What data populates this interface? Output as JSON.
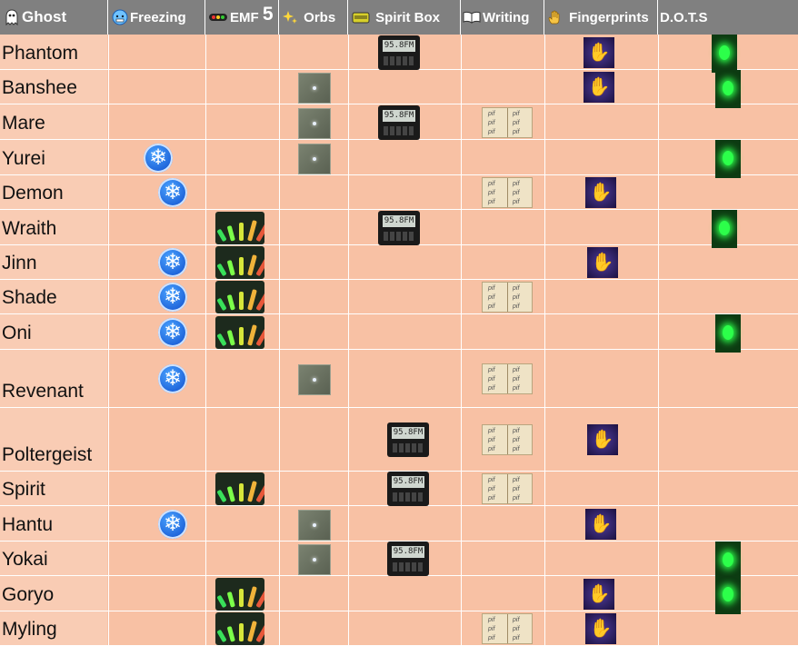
{
  "headers": [
    {
      "label": "Ghost",
      "icon": "ghost-icon"
    },
    {
      "label": "Freezing",
      "icon": "freezing-face-icon"
    },
    {
      "label": "EMF",
      "extra": "5",
      "icon": "emf-reader-icon"
    },
    {
      "label": "Orbs",
      "icon": "sparkles-icon"
    },
    {
      "label": "Spirit Box",
      "icon": "spirit-box-icon"
    },
    {
      "label": "Writing",
      "icon": "open-book-icon"
    },
    {
      "label": "Fingerprints",
      "icon": "raised-hand-icon"
    },
    {
      "label": "D.O.T.S",
      "icon": ""
    }
  ],
  "spirit_box_display": "95.8FM",
  "book_text": "pif",
  "ghosts": [
    {
      "name": "Phantom",
      "evidence": [
        "spiritbox",
        "fingerprints",
        "dots"
      ]
    },
    {
      "name": "Banshee",
      "evidence": [
        "orbs",
        "fingerprints",
        "dots"
      ]
    },
    {
      "name": "Mare",
      "evidence": [
        "orbs",
        "spiritbox",
        "writing"
      ]
    },
    {
      "name": "Yurei",
      "evidence": [
        "freezing",
        "orbs",
        "dots"
      ]
    },
    {
      "name": "Demon",
      "evidence": [
        "freezing",
        "writing",
        "fingerprints"
      ]
    },
    {
      "name": "Wraith",
      "evidence": [
        "emf",
        "spiritbox",
        "dots"
      ]
    },
    {
      "name": "Jinn",
      "evidence": [
        "freezing",
        "emf",
        "fingerprints"
      ]
    },
    {
      "name": "Shade",
      "evidence": [
        "freezing",
        "emf",
        "writing"
      ]
    },
    {
      "name": "Oni",
      "evidence": [
        "freezing",
        "emf",
        "dots"
      ]
    },
    {
      "name": "Revenant",
      "evidence": [
        "freezing",
        "orbs",
        "writing"
      ]
    },
    {
      "name": "Poltergeist",
      "evidence": [
        "spiritbox",
        "writing",
        "fingerprints"
      ]
    },
    {
      "name": "Spirit",
      "evidence": [
        "emf",
        "spiritbox",
        "writing"
      ]
    },
    {
      "name": "Hantu",
      "evidence": [
        "freezing",
        "orbs",
        "fingerprints"
      ]
    },
    {
      "name": "Yokai",
      "evidence": [
        "orbs",
        "spiritbox",
        "dots"
      ]
    },
    {
      "name": "Goryo",
      "evidence": [
        "emf",
        "fingerprints",
        "dots"
      ]
    },
    {
      "name": "Myling",
      "evidence": [
        "emf",
        "writing",
        "fingerprints"
      ]
    }
  ],
  "colors": {
    "header_bg": "#808080",
    "row_bg": "#f8c1a4",
    "name_bg": "#f9ccb4",
    "dots_green": "#2cff4a",
    "freeze_blue": "#0a47c8"
  }
}
